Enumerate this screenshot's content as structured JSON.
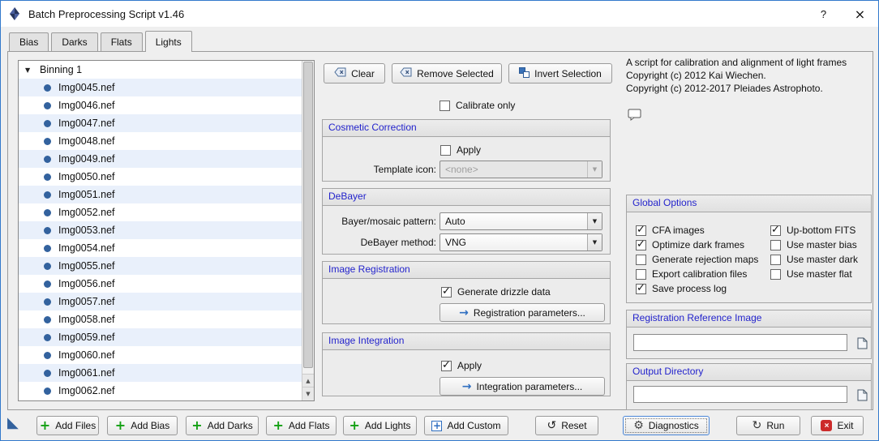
{
  "colors": {
    "accent-blue": "#2f6fc1",
    "title-blue": "#2323cc",
    "row-alt": "#e9f0fb",
    "bullet-blue": "#33629e",
    "plus-green": "#13a013",
    "exit-red": "#cc2b2b",
    "window-border": "#3379cc"
  },
  "window": {
    "title": "Batch Preprocessing Script v1.46",
    "help": "?",
    "close": "×"
  },
  "tabs": [
    {
      "label": "Bias"
    },
    {
      "label": "Darks"
    },
    {
      "label": "Flats"
    },
    {
      "label": "Lights"
    }
  ],
  "file_tree": {
    "root": "Binning 1",
    "files": [
      "Img0045.nef",
      "Img0046.nef",
      "Img0047.nef",
      "Img0048.nef",
      "Img0049.nef",
      "Img0050.nef",
      "Img0051.nef",
      "Img0052.nef",
      "Img0053.nef",
      "Img0054.nef",
      "Img0055.nef",
      "Img0056.nef",
      "Img0057.nef",
      "Img0058.nef",
      "Img0059.nef",
      "Img0060.nef",
      "Img0061.nef",
      "Img0062.nef"
    ]
  },
  "list_toolbar": {
    "clear": "Clear",
    "remove_selected": "Remove Selected",
    "invert_selection": "Invert Selection"
  },
  "calibrate_only": {
    "label": "Calibrate only",
    "checked": false
  },
  "cosmetic_correction": {
    "title": "Cosmetic Correction",
    "apply_label": "Apply",
    "apply_checked": false,
    "template_icon_label": "Template icon:",
    "template_icon_value": "<none>"
  },
  "debayer": {
    "title": "DeBayer",
    "pattern_label": "Bayer/mosaic pattern:",
    "pattern_value": "Auto",
    "method_label": "DeBayer method:",
    "method_value": "VNG"
  },
  "image_registration": {
    "title": "Image Registration",
    "drizzle_label": "Generate drizzle data",
    "drizzle_checked": true,
    "params_button": "Registration parameters..."
  },
  "image_integration": {
    "title": "Image Integration",
    "apply_label": "Apply",
    "apply_checked": true,
    "params_button": "Integration parameters..."
  },
  "about": {
    "description": "A script for calibration and alignment of light frames",
    "copyright1": "Copyright (c) 2012 Kai Wiechen.",
    "copyright2": "Copyright (c) 2012-2017 Pleiades Astrophoto."
  },
  "global_options": {
    "title": "Global Options",
    "left": [
      {
        "label": "CFA images",
        "checked": true
      },
      {
        "label": "Optimize dark frames",
        "checked": true
      },
      {
        "label": "Generate rejection maps",
        "checked": false
      },
      {
        "label": "Export calibration files",
        "checked": false
      },
      {
        "label": "Save process log",
        "checked": true
      }
    ],
    "right": [
      {
        "label": "Up-bottom FITS",
        "checked": true
      },
      {
        "label": "Use master bias",
        "checked": false
      },
      {
        "label": "Use master dark",
        "checked": false
      },
      {
        "label": "Use master flat",
        "checked": false
      }
    ]
  },
  "registration_reference": {
    "title": "Registration Reference Image",
    "value": ""
  },
  "output_directory": {
    "title": "Output Directory",
    "value": ""
  },
  "bottom_bar": {
    "add_files": "Add Files",
    "add_bias": "Add Bias",
    "add_darks": "Add Darks",
    "add_flats": "Add Flats",
    "add_lights": "Add Lights",
    "add_custom": "Add Custom",
    "reset": "Reset",
    "diagnostics": "Diagnostics",
    "run": "Run",
    "exit": "Exit"
  }
}
